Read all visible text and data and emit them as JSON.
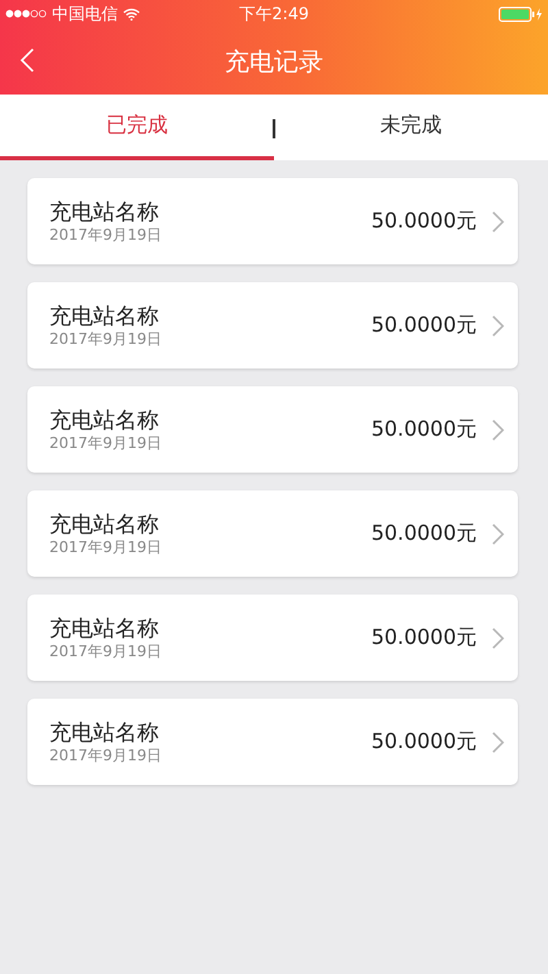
{
  "status_bar": {
    "carrier": "中国电信",
    "time": "下午2:49"
  },
  "nav": {
    "title": "充电记录"
  },
  "tabs": [
    {
      "label": "已完成",
      "selected": true
    },
    {
      "label": "未完成",
      "selected": false
    }
  ],
  "records": [
    {
      "name": "充电站名称",
      "date": "2017年9月19日",
      "amount": "50.0000元"
    },
    {
      "name": "充电站名称",
      "date": "2017年9月19日",
      "amount": "50.0000元"
    },
    {
      "name": "充电站名称",
      "date": "2017年9月19日",
      "amount": "50.0000元"
    },
    {
      "name": "充电站名称",
      "date": "2017年9月19日",
      "amount": "50.0000元"
    },
    {
      "name": "充电站名称",
      "date": "2017年9月19日",
      "amount": "50.0000元"
    },
    {
      "name": "充电站名称",
      "date": "2017年9月19日",
      "amount": "50.0000元"
    }
  ]
}
